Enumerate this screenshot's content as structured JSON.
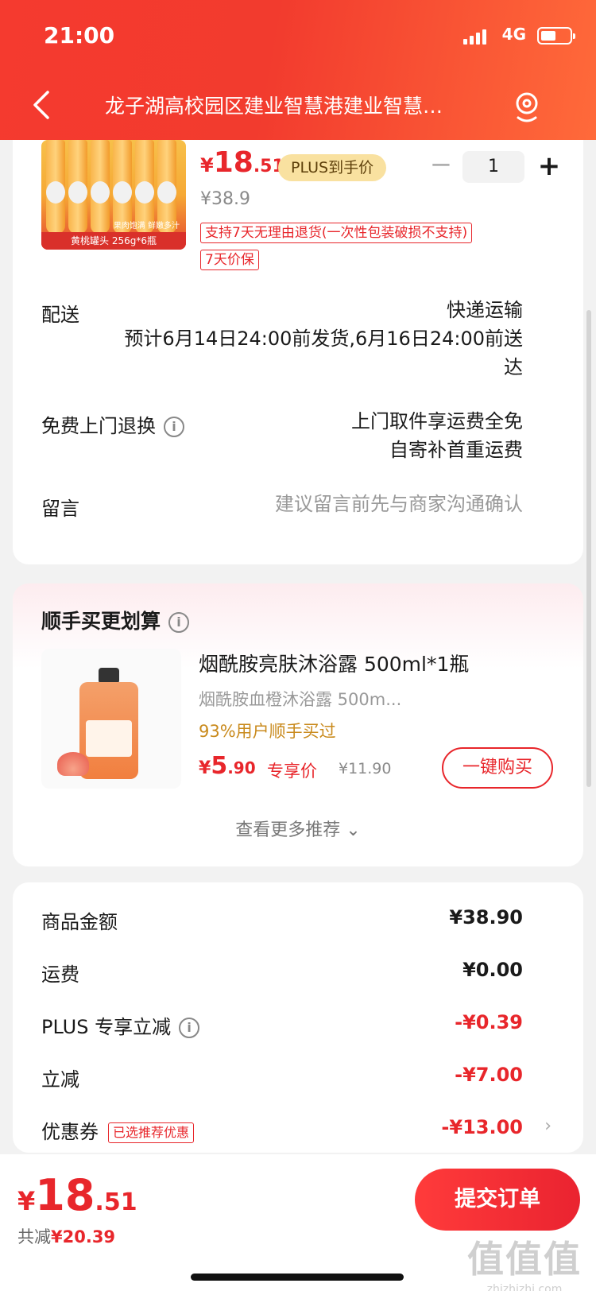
{
  "status": {
    "time": "21:00",
    "network": "4G"
  },
  "nav": {
    "address": "龙子湖高校园区建业智慧港建业智慧…"
  },
  "product": {
    "image_caption": "黄桃罐头 256g*6瓶",
    "image_caption2": "果肉饱满 鲜嫩多汁",
    "price_yen": "¥",
    "price_int": "18",
    "price_dec": ".51",
    "plus_badge": "PLUS到手价",
    "original_price": "¥38.9",
    "quantity": "1",
    "minus": "−",
    "plus": "+",
    "tag_return": "支持7天无理由退货(一次性包装破损不支持)",
    "tag_price_protect": "7天价保"
  },
  "delivery": {
    "label": "配送",
    "method": "快递运输",
    "estimate_line1": "预计6月14日24:00前发货,6月16日24:00前送",
    "estimate_line2": "达"
  },
  "free_return": {
    "label": "免费上门退换",
    "line1": "上门取件享运费全免",
    "line2": "自寄补首重运费"
  },
  "message": {
    "label": "留言",
    "placeholder": "建议留言前先与商家沟通确认"
  },
  "recommend": {
    "title": "顺手买更划算",
    "name": "烟酰胺亮肤沐浴露 500ml*1瓶",
    "subtitle": "烟酰胺血橙沐浴露 500m...",
    "percent_text": "93%用户顺手买过",
    "price_yen": "¥",
    "price_int": "5",
    "price_dec": ".90",
    "exclusive": "专享价",
    "original": "¥11.90",
    "buy_button": "一键购买",
    "more": "查看更多推荐 ⌄"
  },
  "summary": {
    "goods_label": "商品金额",
    "goods_value": "¥38.90",
    "shipping_label": "运费",
    "shipping_value": "¥0.00",
    "plus_label": "PLUS 专享立减",
    "plus_value": "-¥0.39",
    "discount_label": "立减",
    "discount_value": "-¥7.00",
    "coupon_label": "优惠券",
    "coupon_tag": "已选推荐优惠",
    "coupon_value": "-¥13.00"
  },
  "bottom": {
    "total_yen": "¥",
    "total_int": "18",
    "total_dec": ".51",
    "saved_label": "共减",
    "saved_value": "¥20.39",
    "submit": "提交订单",
    "watermark": "值值值",
    "watermark_url": "zhizhizhi.com"
  },
  "colors": {
    "accent": "#e8262b",
    "header": "#f53a2f",
    "plus_badge_bg": "#f9e1a0"
  }
}
